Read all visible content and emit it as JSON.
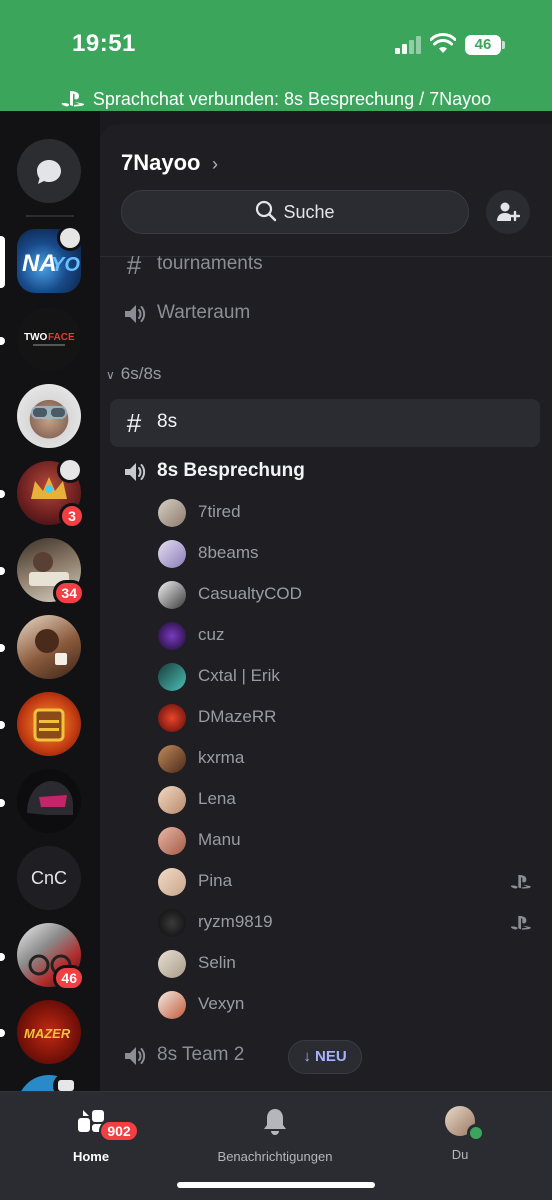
{
  "status_bar": {
    "time": "19:51",
    "battery": "46"
  },
  "voice_banner": {
    "text": "Sprachchat verbunden: 8s Besprechung / 7Nayoo",
    "icon": "playstation-icon"
  },
  "rail": {
    "servers": [
      {
        "name": "NAYOU",
        "badge": ""
      },
      {
        "name": "TWOFACE",
        "badge": ""
      },
      {
        "name": "server-goggles",
        "badge": ""
      },
      {
        "name": "server-crown",
        "badge": "3"
      },
      {
        "name": "server-money",
        "badge": "34"
      },
      {
        "name": "server-man",
        "badge": ""
      },
      {
        "name": "server-chest",
        "badge": ""
      },
      {
        "name": "server-helmet",
        "badge": ""
      },
      {
        "name": "CnC",
        "badge": ""
      },
      {
        "name": "server-bike",
        "badge": "46"
      },
      {
        "name": "MAZER",
        "badge": ""
      }
    ],
    "colors": {
      "unread_badge": "#f23f43"
    }
  },
  "channel_panel": {
    "server_name": "7Nayoo",
    "search_label": "Suche",
    "channels_top": [
      {
        "type": "text",
        "name": "tournaments"
      },
      {
        "type": "voice",
        "name": "Warteraum"
      }
    ],
    "category": "6s/8s",
    "selected_channel": "8s",
    "voice_channel": "8s Besprechung",
    "members": [
      "7tired",
      "8beams",
      "CasualtyCOD",
      "cuz",
      "Cxtal | Erik",
      "DMazeRR",
      "kxrma",
      "Lena",
      "Manu",
      "Pina",
      "ryzm9819",
      "Selin",
      "Vexyn"
    ],
    "members_on_playstation": [
      "Pina",
      "ryzm9819"
    ],
    "voice_channel_2": "8s Team 2",
    "new_pill": "↓ NEU"
  },
  "tabbar": {
    "home": "Home",
    "home_badge": "902",
    "notifications": "Benachrichtigungen",
    "you": "Du"
  }
}
